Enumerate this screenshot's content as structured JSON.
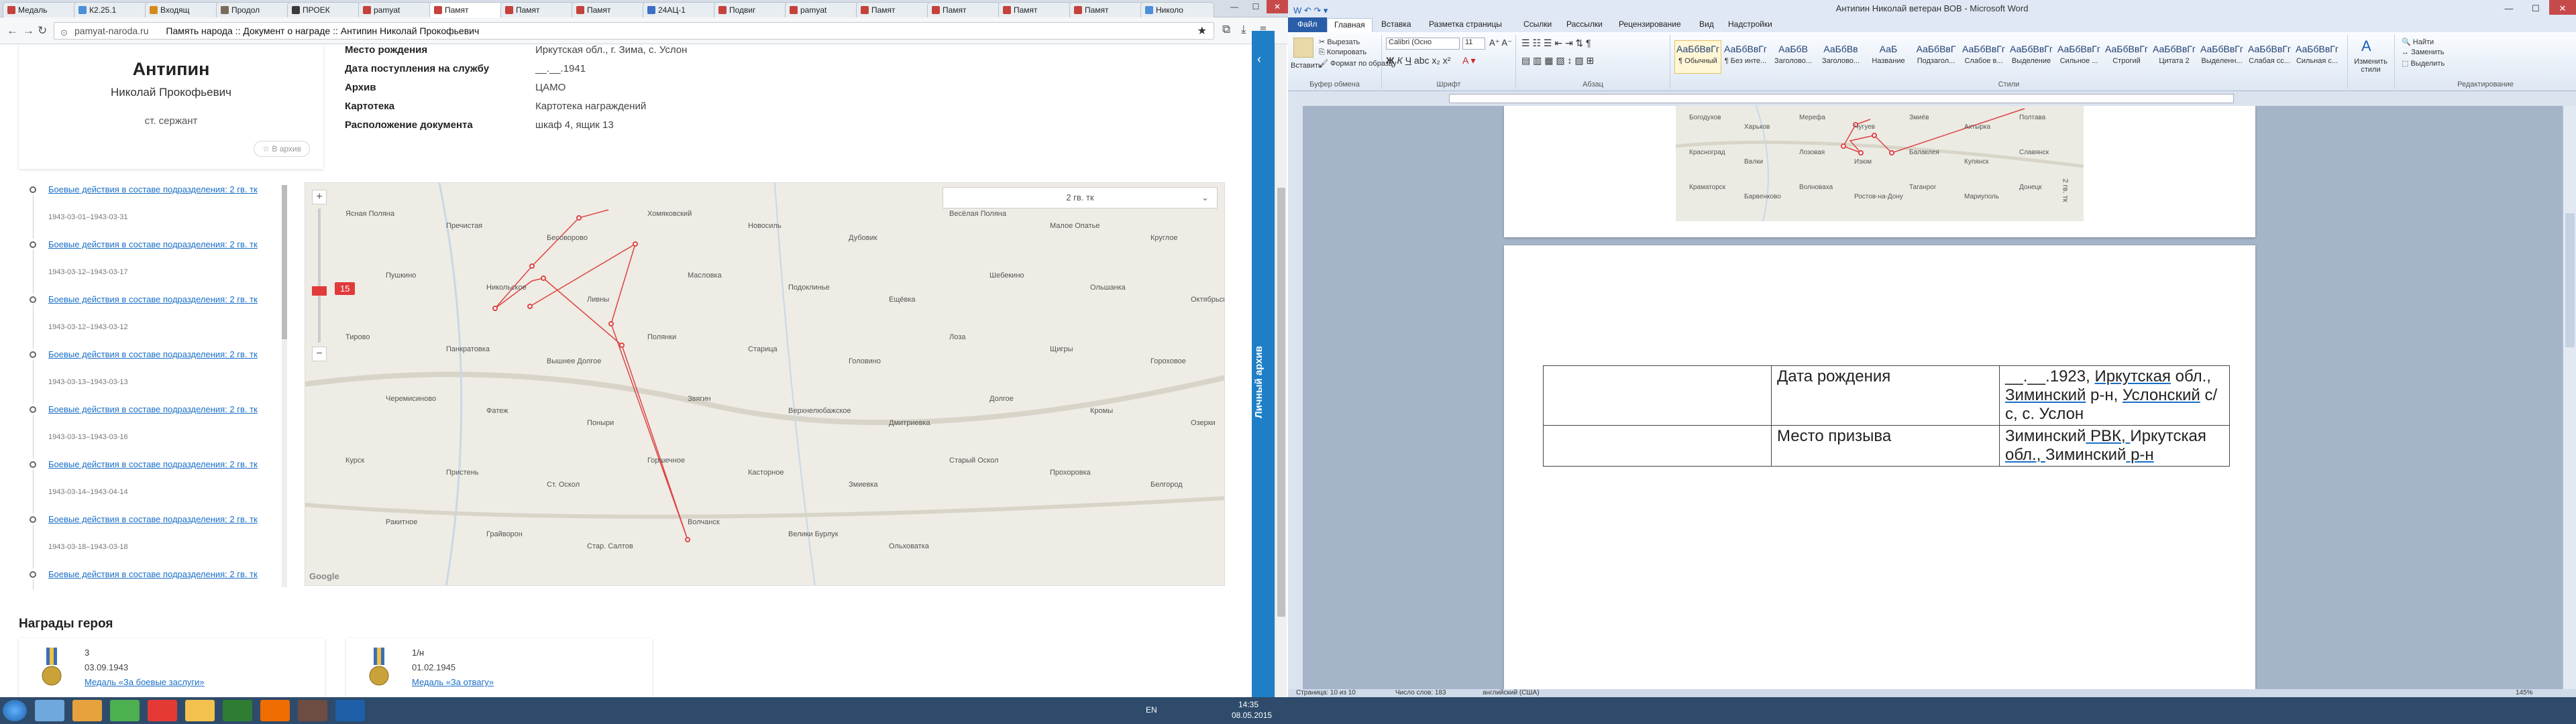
{
  "browser": {
    "tabs": [
      {
        "label": "Медаль",
        "color": "#c4423a"
      },
      {
        "label": "К2.25.1",
        "color": "#4a8fd8"
      },
      {
        "label": "Входящ",
        "color": "#d48a1a"
      },
      {
        "label": "Продол",
        "color": "#7a6a5a"
      },
      {
        "label": "ПРОЕК",
        "color": "#3b3b3b"
      },
      {
        "label": "pamyat",
        "color": "#c4423a"
      },
      {
        "label": "Памят",
        "color": "#c4423a"
      },
      {
        "label": "Памят",
        "color": "#c4423a"
      },
      {
        "label": "Памят",
        "color": "#c4423a"
      },
      {
        "label": "24АЦ-1",
        "color": "#3a6fc4"
      },
      {
        "label": "Подвиг",
        "color": "#c4423a"
      },
      {
        "label": "pamyat",
        "color": "#c4423a"
      },
      {
        "label": "Памят",
        "color": "#c4423a"
      },
      {
        "label": "Памят",
        "color": "#c4423a"
      },
      {
        "label": "Памят",
        "color": "#c4423a"
      },
      {
        "label": "Памят",
        "color": "#c4423a"
      },
      {
        "label": "Николо",
        "color": "#4a8fd8"
      }
    ],
    "active_tab": 6,
    "window_buttons": {
      "minimize": "—",
      "maximize": "☐",
      "close": "✕"
    },
    "url_domain": "pamyat-naroda.ru",
    "page_title": "Память народа :: Документ о награде :: Антипин Николай Прокофьевич"
  },
  "profile": {
    "surname": "Антипин",
    "fullname": "Николай Прокофьевич",
    "rank": "ст. сержант",
    "archive_btn": "☆ В архив"
  },
  "doc_fields": [
    {
      "k": "Место рождения",
      "v": "Иркутская обл., г. Зима, с. Услон"
    },
    {
      "k": "Дата поступления на службу",
      "v": "__.__.1941"
    },
    {
      "k": "Архив",
      "v": "ЦАМО"
    },
    {
      "k": "Картотека",
      "v": "Картотека награждений"
    },
    {
      "k": "Расположение документа",
      "v": "шкаф 4, ящик 13"
    }
  ],
  "battles": [
    {
      "link": "Боевые действия в составе подразделения: 2 гв. тк",
      "dates": "1943-03-01–1943-03-31"
    },
    {
      "link": "Боевые действия в составе подразделения: 2 гв. тк",
      "dates": "1943-03-12–1943-03-17"
    },
    {
      "link": "Боевые действия в составе подразделения: 2 гв. тк",
      "dates": "1943-03-12–1943-03-12"
    },
    {
      "link": "Боевые действия в составе подразделения: 2 гв. тк",
      "dates": "1943-03-13–1943-03-13"
    },
    {
      "link": "Боевые действия в составе подразделения: 2 гв. тк",
      "dates": "1943-03-13–1943-03-16"
    },
    {
      "link": "Боевые действия в составе подразделения: 2 гв. тк",
      "dates": "1943-03-14–1943-04-14"
    },
    {
      "link": "Боевые действия в составе подразделения: 2 гв. тк",
      "dates": "1943-03-18–1943-03-18"
    },
    {
      "link": "Боевые действия в составе подразделения: 2 гв. тк",
      "dates": ""
    }
  ],
  "map": {
    "select_label": "2 гв. тк",
    "badge": "15",
    "zoom_in": "+",
    "zoom_out": "−",
    "google": "Google",
    "labels": [
      "Ясная Поляна",
      "Пречистая",
      "Бесоворово",
      "Хомяковский",
      "Новосиль",
      "Дубовик",
      "Весёлая Поляна",
      "Малое Опатье",
      "Круглое",
      "Пушкино",
      "Никольское",
      "Ливны",
      "Масловка",
      "Подоклинье",
      "Ещёвка",
      "Шебекино",
      "Ольшанка",
      "Октябрьский",
      "Тирово",
      "Панкратовка",
      "Вышнее Долгое",
      "Полянки",
      "Старица",
      "Головино",
      "Лоза",
      "Щигры",
      "Гороховое",
      "Черемисиново",
      "Фатеж",
      "Поныри",
      "Звягин",
      "Верхнелюбажское",
      "Дмитриевка",
      "Долгое",
      "Кромы",
      "Озерки",
      "Курск",
      "Пристень",
      "Ст. Оскол",
      "Горшечное",
      "Касторное",
      "Змиевка",
      "Старый Оскол",
      "Прохоровка",
      "Белгород",
      "Ракитное",
      "Грайворон",
      "Стар. Салтов",
      "Волчанск",
      "Велики Бурлук",
      "Ольховатка"
    ]
  },
  "awards_title": "Награды героя",
  "awards": [
    {
      "count": "3",
      "date": "03.09.1943",
      "name": "Медаль «За боевые заслуги»"
    },
    {
      "count": "1/н",
      "date": "01.02.1945",
      "name": "Медаль «За отвагу»"
    }
  ],
  "vpanel": {
    "text": "Личный архив",
    "arrow": "‹"
  },
  "word": {
    "title": "Антипин Николай ветеран ВОВ - Microsoft Word",
    "tabs": [
      "Файл",
      "Главная",
      "Вставка",
      "Разметка страницы",
      "Ссылки",
      "Рассылки",
      "Рецензирование",
      "Вид",
      "Надстройки"
    ],
    "clipboard": {
      "paste": "Вставить",
      "cut": "Вырезать",
      "copy": "Копировать",
      "format": "Формат по образцу",
      "group": "Буфер обмена"
    },
    "font": {
      "name": "Calibri (Осно",
      "size": "11",
      "group": "Шрифт"
    },
    "paragraph_group": "Абзац",
    "styles": [
      {
        "sample": "АаБбВвГг",
        "name": "¶ Обычный"
      },
      {
        "sample": "АаБбВвГг",
        "name": "¶ Без инте..."
      },
      {
        "sample": "АаБбВ",
        "name": "Заголово..."
      },
      {
        "sample": "АаБбВв",
        "name": "Заголово..."
      },
      {
        "sample": "АаБ",
        "name": "Название"
      },
      {
        "sample": "АаБбВвГ",
        "name": "Подзагол..."
      },
      {
        "sample": "АаБбВвГг",
        "name": "Слабое в..."
      },
      {
        "sample": "АаБбВвГг",
        "name": "Выделение"
      },
      {
        "sample": "АаБбВвГг",
        "name": "Сильное ..."
      },
      {
        "sample": "АаБбВвГг",
        "name": "Строгий"
      },
      {
        "sample": "АаБбВвГг",
        "name": "Цитата 2"
      },
      {
        "sample": "АаБбВвГг",
        "name": "Выделенн..."
      },
      {
        "sample": "АаБбВвГг",
        "name": "Слабая сс..."
      },
      {
        "sample": "АаБбВвГг",
        "name": "Сильная с..."
      }
    ],
    "styles_group": "Стили",
    "change_styles": "Изменить стили",
    "editing": {
      "find": "Найти",
      "replace": "Заменить",
      "select": "Выделить",
      "group": "Редактирование"
    },
    "table": [
      {
        "k": "Дата рождения",
        "v_parts": [
          "__.__.1923, ",
          "Иркутская",
          " обл., ",
          "Зиминский",
          " р-н, ",
          "Услонский",
          " с/с, с. Услон"
        ]
      },
      {
        "k": "Место призыва",
        "v_parts": [
          "Зиминский",
          " РВК, ",
          "Иркутская",
          " обл., ",
          "Зиминский",
          " р-н"
        ]
      }
    ],
    "map_labels": [
      "Богодухов",
      "Харьков",
      "Мерефа",
      "Чугуев",
      "Змиёв",
      "Ахтырка",
      "Полтава",
      "Красноград",
      "Валки",
      "Лозовая",
      "Изюм",
      "Балаклея",
      "Купянск",
      "Славянск",
      "Краматорск",
      "Барвенково",
      "Волноваха",
      "Ростов-на-Дону",
      "Таганрог",
      "Мариуполь",
      "Донецк"
    ],
    "map_scale": "2 гв. тк",
    "status": {
      "page": "Страница: 10 из 10",
      "words": "Число слов: 183",
      "lang": "английский (США)",
      "zoom": "145%"
    }
  },
  "taskbar": {
    "icons": [
      {
        "name": "explorer",
        "color": "#6fa8dc"
      },
      {
        "name": "media-player",
        "color": "#e6a23c"
      },
      {
        "name": "chrome",
        "color": "#4caf50"
      },
      {
        "name": "yandex",
        "color": "#e53935"
      },
      {
        "name": "file-manager",
        "color": "#f2c14e"
      },
      {
        "name": "excel",
        "color": "#2e7d32"
      },
      {
        "name": "firefox",
        "color": "#ef6c00"
      },
      {
        "name": "paint",
        "color": "#6d4c41"
      },
      {
        "name": "word",
        "color": "#1e5fa8"
      }
    ],
    "lang": "EN",
    "time": "14:35",
    "date": "08.05.2015"
  }
}
